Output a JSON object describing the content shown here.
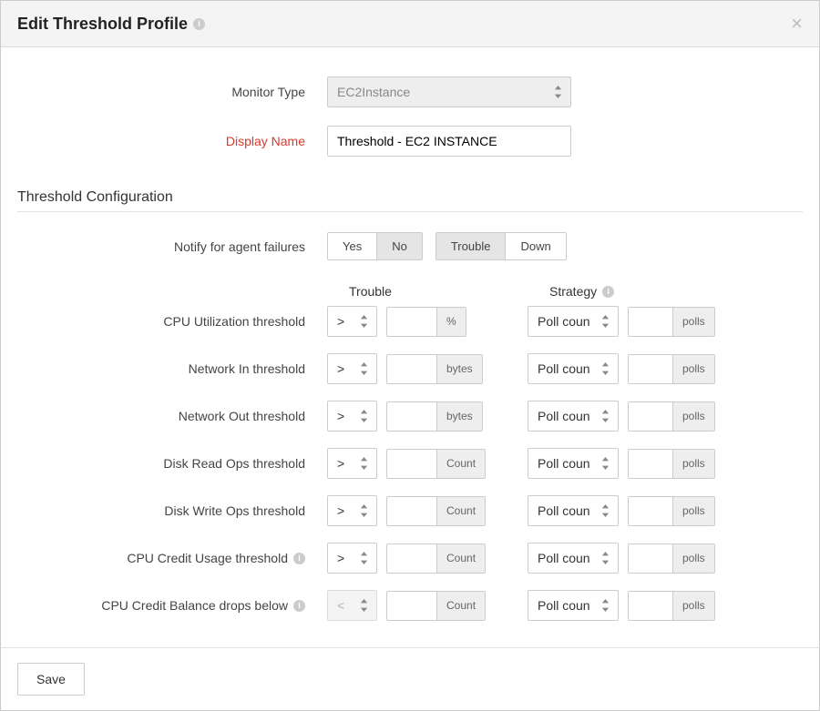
{
  "modal": {
    "title": "Edit Threshold Profile",
    "labels": {
      "monitor_type": "Monitor Type",
      "display_name": "Display Name"
    },
    "values": {
      "monitor_type": "EC2Instance",
      "display_name": "Threshold - EC2 INSTANCE"
    }
  },
  "threshold": {
    "section_title": "Threshold Configuration",
    "notify_label": "Notify for agent failures",
    "notify_yes": "Yes",
    "notify_no": "No",
    "severity_trouble": "Trouble",
    "severity_down": "Down",
    "col_trouble": "Trouble",
    "col_strategy": "Strategy",
    "strategy_default": "Poll count",
    "polls_unit": "polls",
    "rows": [
      {
        "label": "CPU Utilization threshold",
        "op": ">",
        "unit": "%",
        "info": false,
        "disabled": false
      },
      {
        "label": "Network In threshold",
        "op": ">",
        "unit": "bytes",
        "info": false,
        "disabled": false
      },
      {
        "label": "Network Out threshold",
        "op": ">",
        "unit": "bytes",
        "info": false,
        "disabled": false
      },
      {
        "label": "Disk Read Ops threshold",
        "op": ">",
        "unit": "Count",
        "info": false,
        "disabled": false
      },
      {
        "label": "Disk Write Ops threshold",
        "op": ">",
        "unit": "Count",
        "info": false,
        "disabled": false
      },
      {
        "label": "CPU Credit Usage threshold",
        "op": ">",
        "unit": "Count",
        "info": true,
        "disabled": false
      },
      {
        "label": "CPU Credit Balance drops below",
        "op": "<",
        "unit": "Count",
        "info": true,
        "disabled": true
      }
    ]
  },
  "footer": {
    "save": "Save"
  }
}
